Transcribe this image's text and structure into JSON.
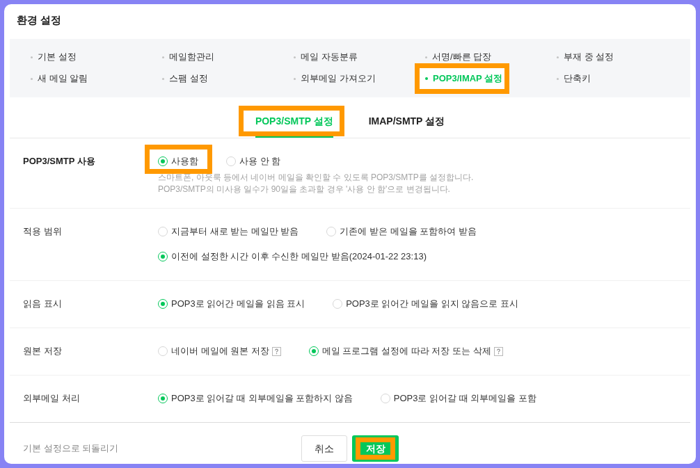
{
  "window": {
    "title": "환경 설정"
  },
  "menu": [
    {
      "label": "기본 설정",
      "selected": false,
      "highlighted": false
    },
    {
      "label": "메일함관리",
      "selected": false,
      "highlighted": false
    },
    {
      "label": "메일 자동분류",
      "selected": false,
      "highlighted": false
    },
    {
      "label": "서명/빠른 답장",
      "selected": false,
      "highlighted": false
    },
    {
      "label": "부재 중 설정",
      "selected": false,
      "highlighted": false
    },
    {
      "label": "새 메일 알림",
      "selected": false,
      "highlighted": false
    },
    {
      "label": "스팸 설정",
      "selected": false,
      "highlighted": false
    },
    {
      "label": "외부메일 가져오기",
      "selected": false,
      "highlighted": false
    },
    {
      "label": "POP3/IMAP 설정",
      "selected": true,
      "highlighted": true
    },
    {
      "label": "단축키",
      "selected": false,
      "highlighted": false
    }
  ],
  "tabs": [
    {
      "label": "POP3/SMTP 설정",
      "selected": true,
      "highlighted": true
    },
    {
      "label": "IMAP/SMTP 설정",
      "selected": false,
      "highlighted": false
    }
  ],
  "settings": [
    {
      "label": "POP3/SMTP 사용",
      "emphasized": true,
      "option_lines": [
        [
          {
            "label": "사용함",
            "selected": true,
            "highlighted": true,
            "help_icon": false
          },
          {
            "label": "사용 안 함",
            "selected": false,
            "highlighted": false,
            "help_icon": false
          }
        ]
      ],
      "description": [
        "스마트폰, 아웃룩 등에서 네이버 메일을 확인할 수 있도록 POP3/SMTP를 설정합니다.",
        "POP3/SMTP의 미사용 일수가 90일을 초과할 경우 '사용 안 함'으로 변경됩니다."
      ]
    },
    {
      "label": "적용 범위",
      "emphasized": false,
      "option_lines": [
        [
          {
            "label": "지금부터 새로 받는 메일만 받음",
            "selected": false,
            "highlighted": false,
            "help_icon": false
          },
          {
            "label": "기존에 받은 메일을 포함하여 받음",
            "selected": false,
            "highlighted": false,
            "help_icon": false
          }
        ],
        [
          {
            "label": "이전에 설정한 시간 이후 수신한 메일만 받음(2024-01-22 23:13)",
            "selected": true,
            "highlighted": false,
            "help_icon": false
          }
        ]
      ]
    },
    {
      "label": "읽음 표시",
      "emphasized": false,
      "option_lines": [
        [
          {
            "label": "POP3로 읽어간 메일을 읽음 표시",
            "selected": true,
            "highlighted": false,
            "help_icon": false
          },
          {
            "label": "POP3로 읽어간 메일을 읽지 않음으로 표시",
            "selected": false,
            "highlighted": false,
            "help_icon": false
          }
        ]
      ]
    },
    {
      "label": "원본 저장",
      "emphasized": false,
      "option_lines": [
        [
          {
            "label": "네이버 메일에 원본 저장",
            "selected": false,
            "highlighted": false,
            "help_icon": true
          },
          {
            "label": "메일 프로그램 설정에 따라 저장 또는 삭제",
            "selected": true,
            "highlighted": false,
            "help_icon": true
          }
        ]
      ]
    },
    {
      "label": "외부메일 처리",
      "emphasized": false,
      "option_lines": [
        [
          {
            "label": "POP3로 읽어갈 때 외부메일을 포함하지 않음",
            "selected": true,
            "highlighted": false,
            "help_icon": false
          },
          {
            "label": "POP3로 읽어갈 때 외부메일을 포함",
            "selected": false,
            "highlighted": false,
            "help_icon": false
          }
        ]
      ]
    }
  ],
  "footer": {
    "reset_link": "기본 설정으로 되돌리기",
    "buttons": [
      {
        "label": "취소",
        "kind": "cancel",
        "highlighted": false
      },
      {
        "label": "저장",
        "kind": "save",
        "highlighted": true
      }
    ]
  }
}
